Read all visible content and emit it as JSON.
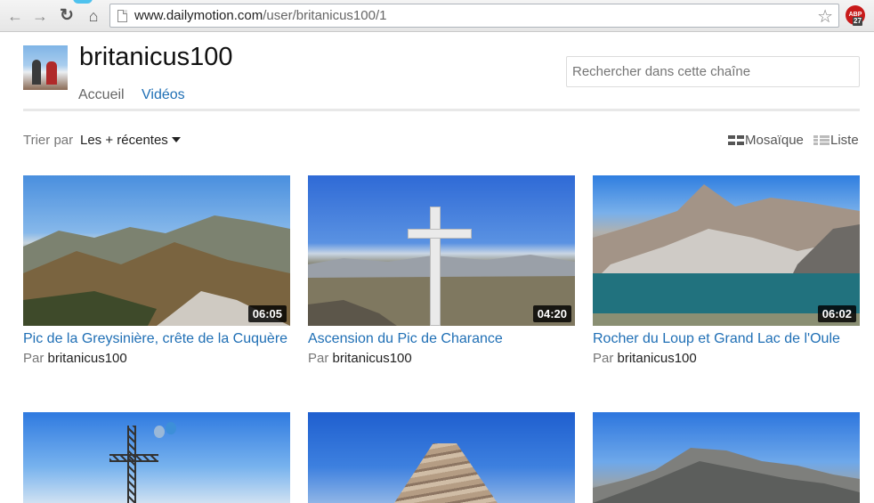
{
  "browser": {
    "url_domain": "www.dailymotion.com",
    "url_path": "/user/britanicus100/1",
    "extension_badge": "ABP",
    "extension_count": "27"
  },
  "channel": {
    "name": "britanicus100",
    "tabs": [
      {
        "label": "Accueil",
        "active": false
      },
      {
        "label": "Vidéos",
        "active": true
      }
    ],
    "search_placeholder": "Rechercher dans cette chaîne"
  },
  "sort": {
    "label": "Trier par",
    "value": "Les + récentes"
  },
  "views": {
    "mosaic": "Mosaïque",
    "list": "Liste"
  },
  "videos": [
    {
      "title": "Pic de la Greysinière, crête de la Cuquère",
      "duration": "06:05",
      "by_label": "Par",
      "author": "britanicus100"
    },
    {
      "title": "Ascension du Pic de Charance",
      "duration": "04:20",
      "by_label": "Par",
      "author": "britanicus100"
    },
    {
      "title": "Rocher du Loup et Grand Lac de l'Oule",
      "duration": "06:02",
      "by_label": "Par",
      "author": "britanicus100"
    },
    {
      "title": "",
      "duration": "",
      "by_label": "",
      "author": ""
    },
    {
      "title": "",
      "duration": "",
      "by_label": "",
      "author": ""
    },
    {
      "title": "",
      "duration": "",
      "by_label": "",
      "author": ""
    }
  ],
  "colors": {
    "accent": "#1f6fb5",
    "text": "#222222",
    "muted": "#777777"
  }
}
